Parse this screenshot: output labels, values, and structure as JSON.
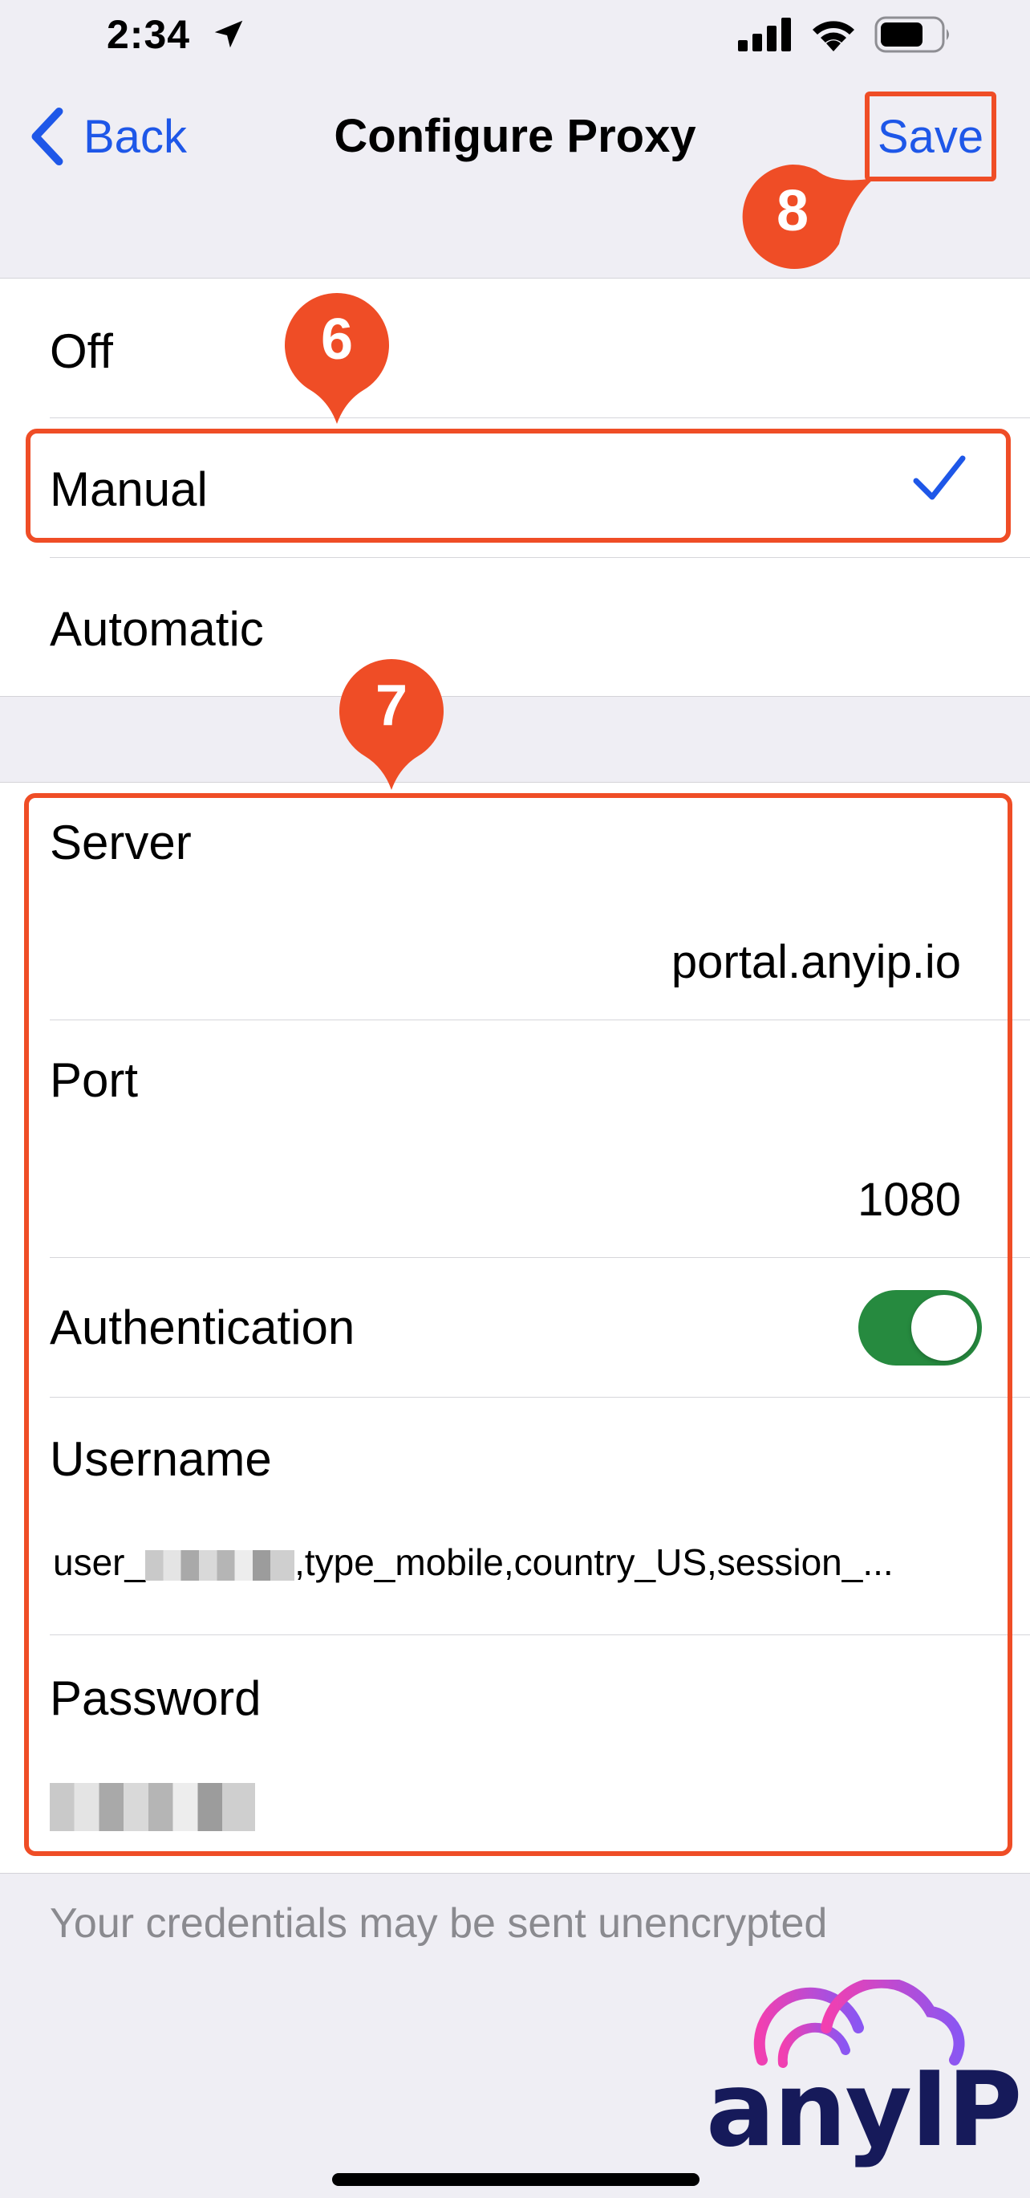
{
  "status_bar": {
    "time": "2:34"
  },
  "nav": {
    "back_label": "Back",
    "title": "Configure Proxy",
    "save_label": "Save"
  },
  "proxy_modes": {
    "items": [
      {
        "label": "Off"
      },
      {
        "label": "Manual",
        "selected": true
      },
      {
        "label": "Automatic"
      }
    ]
  },
  "fields": {
    "server": {
      "label": "Server",
      "value": "portal.anyip.io"
    },
    "port": {
      "label": "Port",
      "value": "1080"
    },
    "authentication": {
      "label": "Authentication",
      "enabled": true
    },
    "username": {
      "label": "Username",
      "prefix": "user_",
      "suffix": ",type_mobile,country_US,session_..."
    },
    "password": {
      "label": "Password"
    }
  },
  "footer_note": "Your credentials may be sent unencrypted",
  "annotations": {
    "badge_6": "6",
    "badge_7": "7",
    "badge_8": "8"
  },
  "colors": {
    "accent_blue": "#1e57e8",
    "annotation_orange": "#ef4d26",
    "toggle_green": "#268a3f",
    "logo_navy": "#161a5a"
  },
  "logo": {
    "text": "anyIP"
  }
}
